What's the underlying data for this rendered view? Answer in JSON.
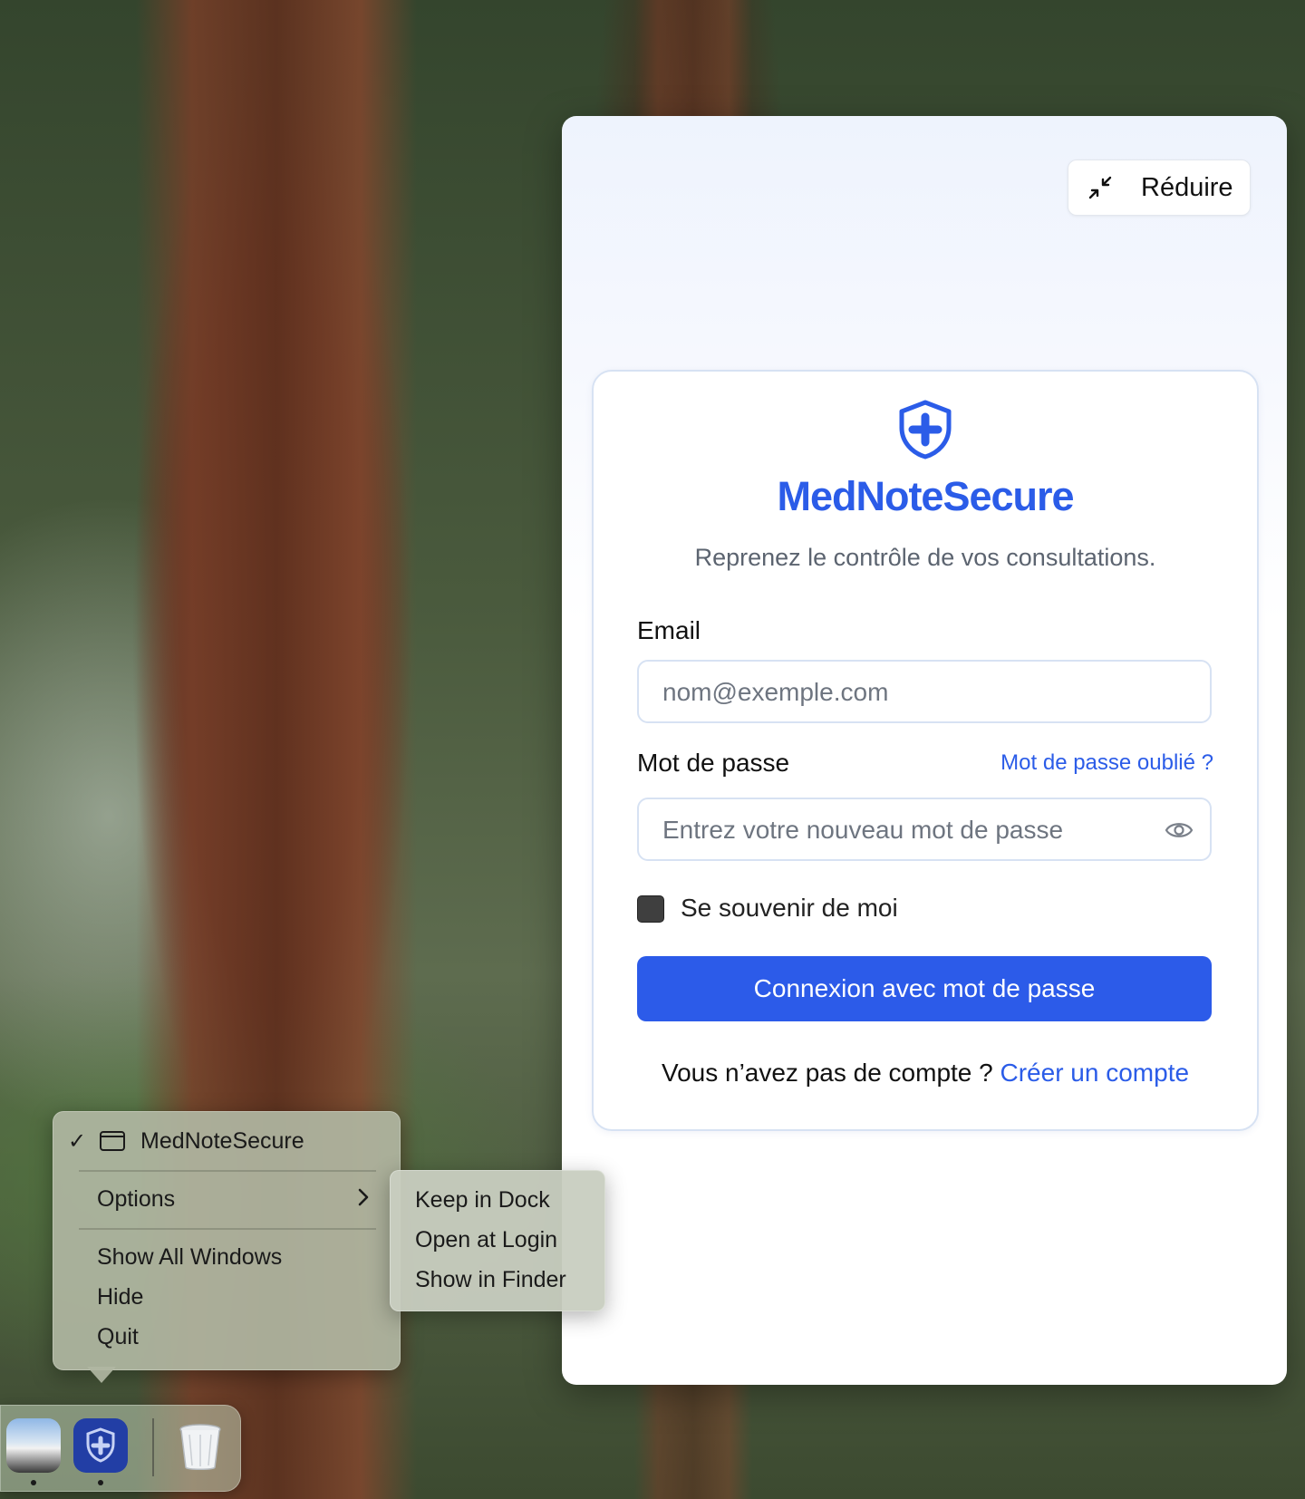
{
  "app_window": {
    "reduce_label": "Réduire",
    "brand_title": "MedNoteSecure",
    "tagline": "Reprenez le contrôle de vos consultations.",
    "email": {
      "label": "Email",
      "value": "",
      "placeholder": "nom@exemple.com"
    },
    "password": {
      "label": "Mot de passe",
      "value": "",
      "placeholder": "Entrez votre nouveau mot de passe",
      "forgot_link": "Mot de passe oublié ?"
    },
    "remember_me": {
      "label": "Se souvenir de moi",
      "checked": false
    },
    "login_button": "Connexion avec mot de passe",
    "signup_prompt": "Vous n’avez pas de compte ?",
    "signup_link": "Créer un compte",
    "colors": {
      "accent": "#2c5be9",
      "brand": "#2b5ce8"
    }
  },
  "dock_menu": {
    "app_item": {
      "label": "MedNoteSecure",
      "checked": true,
      "icon": "window-icon"
    },
    "options_label": "Options",
    "items": [
      "Show All Windows",
      "Hide",
      "Quit"
    ],
    "submenu": [
      "Keep in Dock",
      "Open at Login",
      "Show in Finder"
    ]
  },
  "dock": {
    "apps": [
      {
        "name": "preview-app-icon",
        "running": true
      },
      {
        "name": "mednotesecure-app-icon",
        "running": true
      },
      {
        "name": "trash-icon",
        "running": false
      }
    ]
  }
}
